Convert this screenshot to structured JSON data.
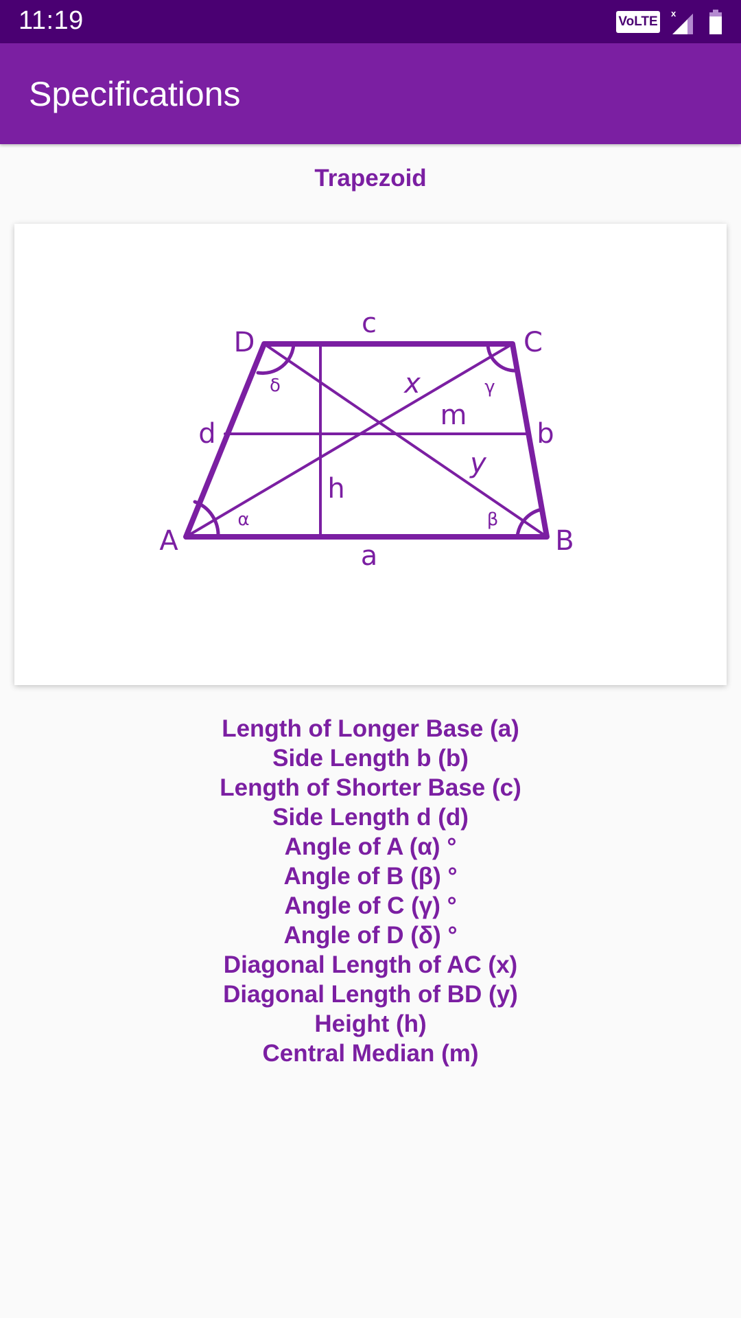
{
  "status_bar": {
    "time": "11:19",
    "volte_label": "VoLTE",
    "signal_no_service_mark": "x",
    "icons": [
      "volte-icon",
      "signal-icon",
      "battery-icon"
    ]
  },
  "app_bar": {
    "title": "Specifications"
  },
  "shape": {
    "title": "Trapezoid",
    "diagram": {
      "color": "#7b1fa2",
      "vertex_labels": [
        "A",
        "B",
        "C",
        "D"
      ],
      "side_labels": [
        "a",
        "b",
        "c",
        "d"
      ],
      "angle_labels": [
        "α",
        "β",
        "γ",
        "δ"
      ],
      "diagonal_labels": [
        "x",
        "y"
      ],
      "height_label": "h",
      "median_label": "m"
    }
  },
  "specifications": [
    "Length of Longer Base (a)",
    "Side Length b (b)",
    "Length of Shorter Base (c)",
    "Side Length d (d)",
    "Angle of A (α) °",
    "Angle of B (β) °",
    "Angle of C (γ) °",
    "Angle of D (δ) °",
    "Diagonal Length of AC (x)",
    "Diagonal Length of BD (y)",
    "Height (h)",
    "Central Median (m)"
  ],
  "colors": {
    "status_bar": "#4a0072",
    "app_bar": "#7b1fa2",
    "accent": "#7b1fa2",
    "background": "#fafafa"
  }
}
